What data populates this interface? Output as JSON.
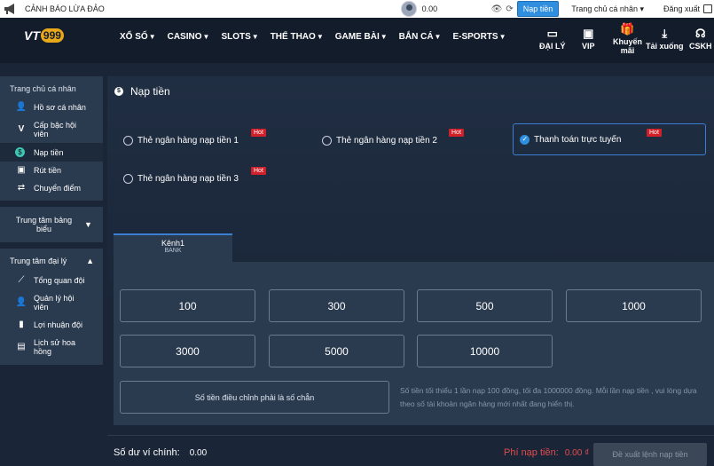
{
  "topbar": {
    "warning": "CẢNH BÁO LỪA ĐẢO",
    "balance": "0.00",
    "topup_label": "Nạp tiền",
    "personal_menu": "Trang chủ cá nhân ▾",
    "logout": "Đăng xuất"
  },
  "header": {
    "logo_vt": "VT",
    "logo_num": "999",
    "nav": [
      "XỔ SỐ",
      "CASINO",
      "SLOTS",
      "THỂ THAO",
      "GAME BÀI",
      "BẮN CÁ",
      "E-SPORTS"
    ],
    "quick": {
      "agent": "ĐẠI LÝ",
      "vip": "VIP",
      "promo_1": "Khuyến",
      "promo_2": "mãi",
      "download": "Tải xuống",
      "support": "CSKH"
    }
  },
  "sidebar": {
    "personal_title": "Trang chủ cá nhân",
    "items": [
      "Hồ sơ cá nhân",
      "Cấp bậc hội viên",
      "Nạp tiền",
      "Rút tiền",
      "Chuyển điểm"
    ],
    "reports": "Trung tâm bảng biểu",
    "agent_center": "Trung tâm đại lý",
    "agent_items": [
      "Tổng quan đội",
      "Quản lý hội viên",
      "Lợi nhuận đội",
      "Lịch sử hoa hồng"
    ]
  },
  "main": {
    "title": "Nạp tiền",
    "hot": "Hot",
    "methods": [
      "Thẻ ngân hàng nạp tiền 1",
      "Thẻ ngân hàng nạp tiền 2",
      "Thanh toán trực tuyến",
      "Thẻ ngân hàng nạp tiền 3"
    ],
    "selected_method": "Thanh toán trực tuyến",
    "channel": {
      "name": "Kênh1",
      "type": "BANK"
    },
    "amounts": [
      "100",
      "300",
      "500",
      "1000",
      "3000",
      "5000",
      "10000"
    ],
    "amount_placeholder": "Số tiền điều chỉnh phải là số chẵn",
    "note": "Số tiền tối thiểu 1 lần nạp 100 đồng, tối đa 1000000 đồng. Mỗi lần nạp tiền , vui lòng dựa theo số tài khoản ngân hàng mới nhất đang hiển thị.",
    "wallet_label": "Số dư ví chính:",
    "wallet_value": "0.00",
    "fee_label": "Phí nạp tiền:",
    "fee_value": "0.00 ₫",
    "submit_label": "Đề xuất lệnh nạp tiền"
  }
}
